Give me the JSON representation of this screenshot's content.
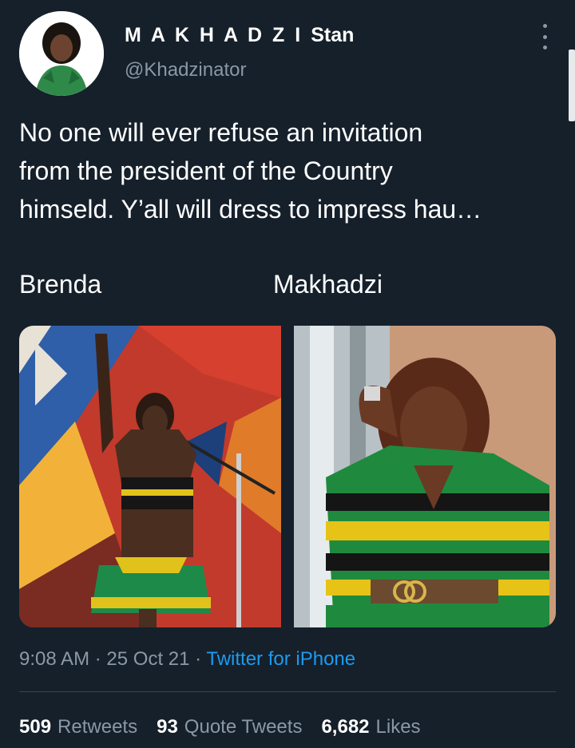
{
  "user": {
    "display_name": "M A K H A D Z I",
    "display_name_suffix": "Stan",
    "handle": "@Khadzinator",
    "avatar_icon": "profile-photo"
  },
  "tweet": {
    "text_lines": [
      "No one will ever refuse an invitation",
      "from the president of the Country",
      "himseld. Y’all will dress to impress hau…"
    ],
    "caption_left": "Brenda",
    "caption_right": "Makhadzi"
  },
  "meta": {
    "time": "9:08 AM",
    "separator": "·",
    "date": "25 Oct 21",
    "source": "Twitter for iPhone"
  },
  "stats": {
    "retweets_count": "509",
    "retweets_label": "Retweets",
    "quotes_count": "93",
    "quotes_label": "Quote Tweets",
    "likes_count": "6,682",
    "likes_label": "Likes"
  },
  "colors": {
    "background": "#15202b",
    "secondary_text": "#8b98a5",
    "link": "#1d9bf0"
  }
}
